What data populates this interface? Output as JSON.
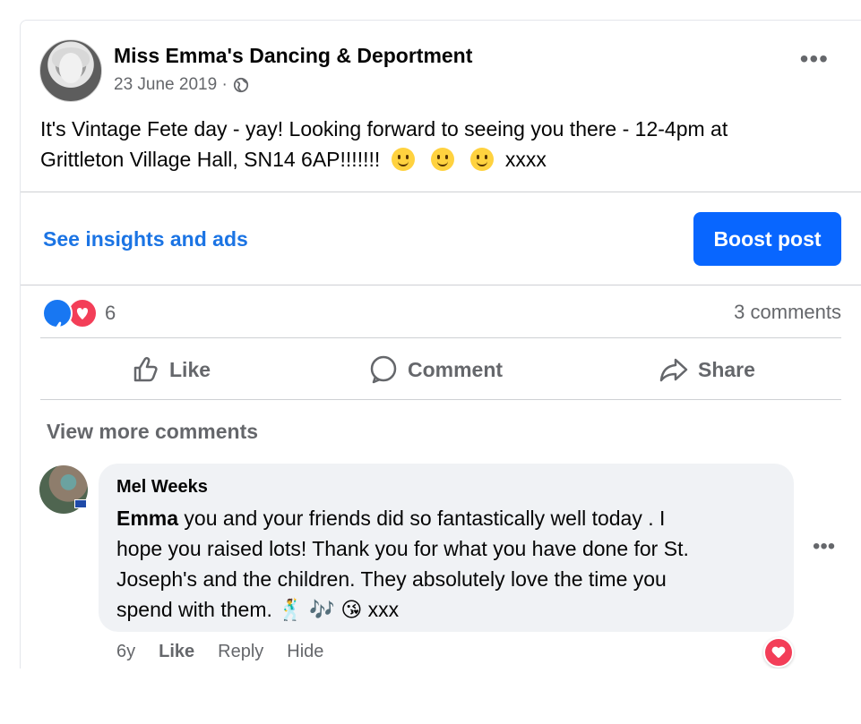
{
  "post": {
    "author": "Miss Emma's Dancing & Deportment",
    "date": "23 June 2019 ·",
    "text_line1": "It's Vintage Fete day - yay! Looking forward to seeing you there - 12-4pm at",
    "text_line2": "Grittleton Village Hall, SN14 6AP!!!!!!!",
    "text_suffix": "xxxx",
    "icons": [
      "globe-icon",
      "more-options-icon",
      "smile-emoji-icon"
    ]
  },
  "insights": {
    "link": "See insights and ads",
    "boost": "Boost post"
  },
  "reactions": {
    "count": "6",
    "comments": "3 comments",
    "colors": {
      "like": "#1877f2",
      "love": "#f33e58"
    }
  },
  "actions": {
    "like": "Like",
    "comment": "Comment",
    "share": "Share"
  },
  "comments_section": {
    "view_more": "View more comments"
  },
  "comment": {
    "author": "Mel Weeks",
    "mention": "Emma",
    "text1": " you and your friends did so fantastically well today . I",
    "text2": "hope you raised lots! Thank you for what you have done for St.",
    "text3": "Joseph's and the children. They absolutely love the time you",
    "text4": "spend with them. 🕺 🎶 😘 xxx",
    "time": "6y",
    "like": "Like",
    "reply": "Reply",
    "hide": "Hide"
  }
}
